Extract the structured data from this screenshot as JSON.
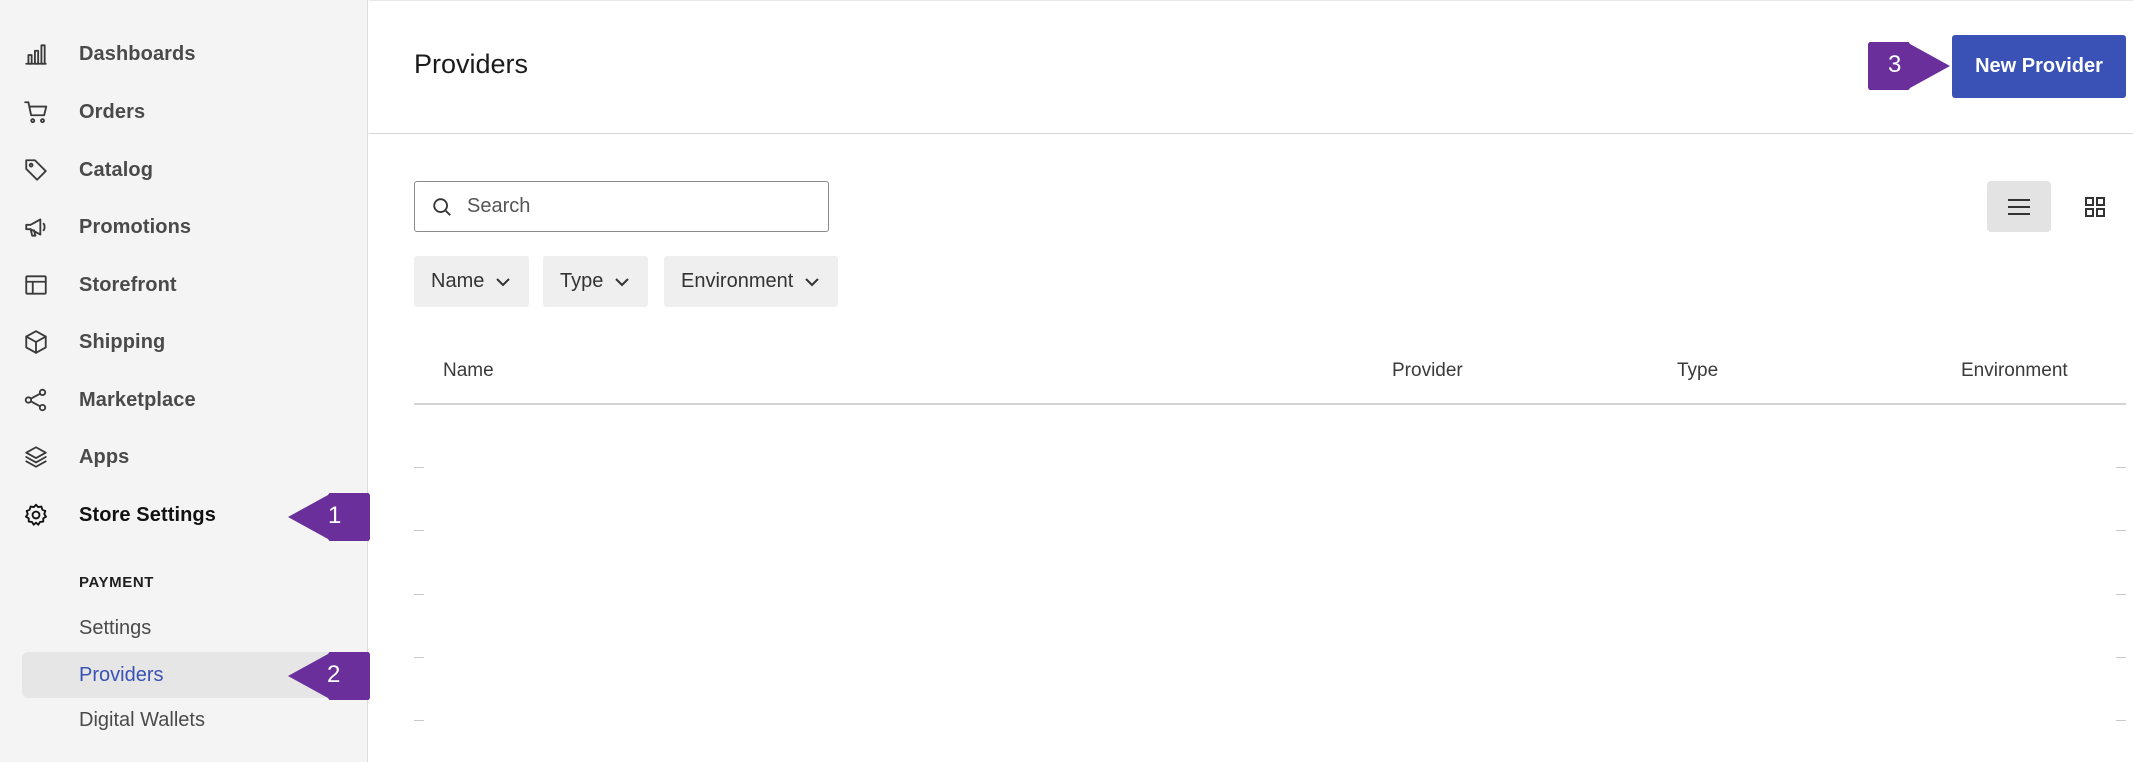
{
  "sidebar": {
    "items": [
      {
        "label": "Dashboards",
        "icon": "bar-chart-icon"
      },
      {
        "label": "Orders",
        "icon": "cart-icon"
      },
      {
        "label": "Catalog",
        "icon": "tag-icon"
      },
      {
        "label": "Promotions",
        "icon": "megaphone-icon"
      },
      {
        "label": "Storefront",
        "icon": "layout-icon"
      },
      {
        "label": "Shipping",
        "icon": "box-icon"
      },
      {
        "label": "Marketplace",
        "icon": "share-icon"
      },
      {
        "label": "Apps",
        "icon": "layers-icon"
      },
      {
        "label": "Store Settings",
        "icon": "gear-icon"
      }
    ],
    "active_item": "Store Settings",
    "section_heading": "PAYMENT",
    "sub_items": [
      {
        "label": "Settings"
      },
      {
        "label": "Providers"
      },
      {
        "label": "Digital Wallets"
      }
    ],
    "active_sub_item": "Providers"
  },
  "callouts": [
    "1",
    "2",
    "3"
  ],
  "header": {
    "title": "Providers",
    "new_button_label": "New Provider"
  },
  "search": {
    "placeholder": "Search",
    "value": ""
  },
  "filters": [
    {
      "label": "Name"
    },
    {
      "label": "Type"
    },
    {
      "label": "Environment"
    }
  ],
  "table": {
    "columns": [
      "Name",
      "Provider",
      "Type",
      "Environment"
    ],
    "rows": []
  },
  "view_mode": "list",
  "colors": {
    "accent": "#3a52b5",
    "callout": "#6a2f9b",
    "sidebar_bg": "#f4f4f4"
  }
}
